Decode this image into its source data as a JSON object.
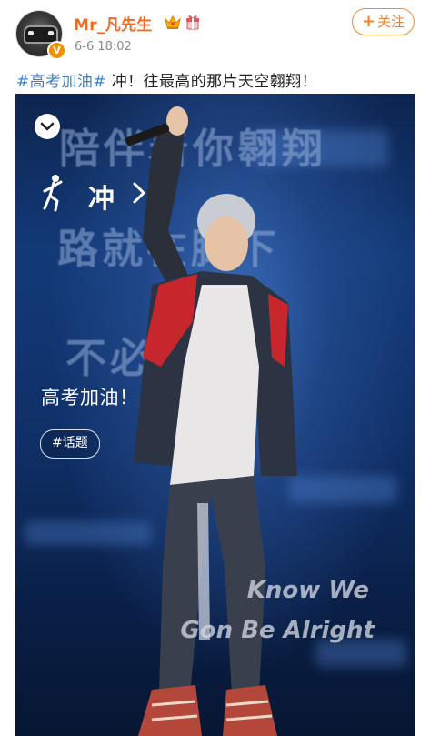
{
  "post": {
    "username": "Mr_凡先生",
    "verified_badge": "V",
    "timestamp": "6-6 18:02",
    "follow_label": "关注",
    "follow_plus": "+",
    "hashtag": "#高考加油#",
    "text": " 冲！往最高的那片天空翱翔！"
  },
  "image": {
    "bg_lines": [
      "陪伴着你翱翔",
      "路就在脚下",
      "不必害怕"
    ],
    "chong_label": "冲",
    "caption": "高考加油！",
    "topic_chip": "#话题",
    "song_line1": "Know We",
    "song_line2": "Gon Be Alright"
  },
  "colors": {
    "username": "#f26a21",
    "hashtag": "#3f7fc9",
    "follow": "#f08030",
    "background_blue": "#133a78"
  },
  "icons": {
    "crown": "crown-icon",
    "gift": "gift-icon",
    "collapse": "chevron-down-icon",
    "runner": "runner-icon",
    "arrow": "chevron-right-icon"
  }
}
